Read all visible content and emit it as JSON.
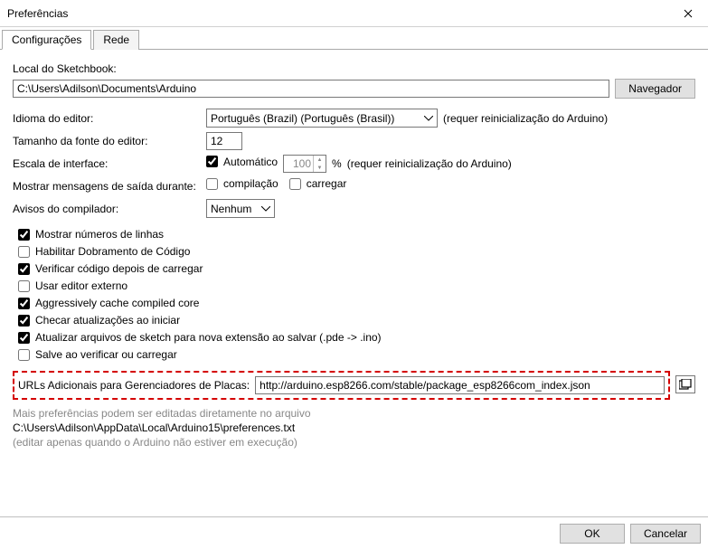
{
  "window": {
    "title": "Preferências"
  },
  "tabs": {
    "settings": "Configurações",
    "network": "Rede"
  },
  "sketchbook": {
    "label": "Local do Sketchbook:",
    "value": "C:\\Users\\Adilson\\Documents\\Arduino",
    "browse": "Navegador"
  },
  "editor_lang": {
    "label": "Idioma do editor:",
    "value": "Português (Brazil) (Português (Brasil))",
    "note": "(requer reinicialização do Arduino)"
  },
  "font_size": {
    "label": "Tamanho da fonte do editor:",
    "value": "12"
  },
  "interface_scale": {
    "label": "Escala de interface:",
    "auto_label": "Automático",
    "value": "100",
    "percent": "%",
    "note": "(requer reinicialização do Arduino)"
  },
  "output_msgs": {
    "label": "Mostrar mensagens de saída durante:",
    "compile": "compilação",
    "upload": "carregar"
  },
  "compiler_warnings": {
    "label": "Avisos do compilador:",
    "value": "Nenhum"
  },
  "checks": {
    "line_numbers": "Mostrar números de linhas",
    "code_folding": "Habilitar Dobramento de Código",
    "verify_after_upload": "Verificar código depois de carregar",
    "external_editor": "Usar editor externo",
    "cache_core": "Aggressively cache compiled core",
    "check_updates": "Checar atualizações ao iniciar",
    "update_sketch_ext": "Atualizar arquivos de sketch para nova extensão ao salvar (.pde -> .ino)",
    "save_on_verify": "Salve ao verificar ou carregar"
  },
  "boards_url": {
    "label": "URLs Adicionais para Gerenciadores de Placas:",
    "value": "http://arduino.esp8266.com/stable/package_esp8266com_index.json"
  },
  "more_prefs": {
    "line1": "Mais preferências podem ser editadas diretamente no arquivo",
    "path": "C:\\Users\\Adilson\\AppData\\Local\\Arduino15\\preferences.txt",
    "line2": "(editar apenas quando o Arduino não estiver em execução)"
  },
  "footer": {
    "ok": "OK",
    "cancel": "Cancelar"
  }
}
